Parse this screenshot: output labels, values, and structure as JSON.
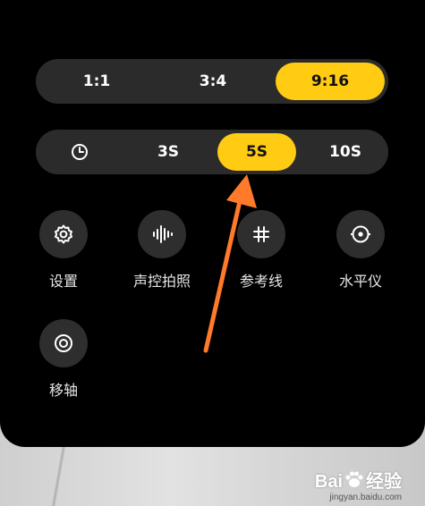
{
  "ratio_selector": {
    "options": [
      "1:1",
      "3:4",
      "9:16"
    ],
    "selected": "9:16"
  },
  "timer_selector": {
    "options": [
      "3S",
      "5S",
      "10S"
    ],
    "selected": "5S",
    "icon": "clock-icon"
  },
  "tools": [
    {
      "label": "设置",
      "icon": "gear-icon"
    },
    {
      "label": "声控拍照",
      "icon": "soundwave-icon"
    },
    {
      "label": "参考线",
      "icon": "grid-icon"
    },
    {
      "label": "水平仪",
      "icon": "level-icon"
    },
    {
      "label": "移轴",
      "icon": "tilt-shift-icon"
    }
  ],
  "watermark": {
    "brand_left": "Bai",
    "brand_right": "经验",
    "url": "jingyan.baidu.com"
  },
  "colors": {
    "accent": "#ffcb13",
    "annotation_arrow": "#ff7a2a"
  }
}
